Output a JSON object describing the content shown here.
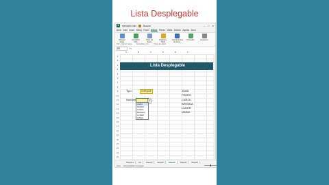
{
  "video_title": "Lista Desplegable",
  "window": {
    "title": "ejemplos.xlsx",
    "search": "Buscar"
  },
  "menu": [
    "Arch",
    "Inici",
    "Inser",
    "Dibuj",
    "Form",
    "Datos",
    "Revis",
    "Vista",
    "Autom",
    "Ayuda",
    "Acro"
  ],
  "menu_active": "Datos",
  "ribbon": {
    "groups": [
      {
        "label": "Obtener datos",
        "icon": "database-icon",
        "color": "#5b8fd0"
      },
      {
        "label": "Actualizar todo",
        "icon": "refresh-icon",
        "color": "#4a9b5e"
      },
      {
        "label": "Tipos de datos",
        "icon": "datatype-icon",
        "color": "#7a9acc"
      },
      {
        "label": "Ordenar y filtrar",
        "icon": "filter-icon",
        "color": "#d8a930"
      },
      {
        "label": "Herramientas de datos",
        "icon": "datatools-icon",
        "color": "#3d6fb0"
      },
      {
        "label": "Previsión",
        "icon": "forecast-icon",
        "color": "#5aa06a"
      },
      {
        "label": "Esquema",
        "icon": "outline-icon",
        "color": "#888888"
      }
    ],
    "group_captions": [
      "Obt. y transf. datos",
      "Consultas y co...",
      "Tipos de datos"
    ]
  },
  "namebox": "B5",
  "columns": [
    "A",
    "B",
    "C",
    "D",
    "E",
    "F"
  ],
  "rows": [
    "1",
    "2",
    "3",
    "4",
    "5",
    "6",
    "7",
    "8",
    "9",
    "10",
    "11",
    "12",
    "13",
    "14",
    "15",
    "16",
    "17",
    "18",
    "19",
    "20",
    "21",
    "22",
    "23",
    "24"
  ],
  "sheet": {
    "banner": "Lista Desplegable",
    "tipo_label": "Tipo:",
    "tipo_value": "CHEQUE",
    "nombre_label": "Nombre:",
    "dropdown_items": [
      "JUAN",
      "PEDRO",
      "CAROL",
      "BRENDA",
      "LUDER",
      "IANNA"
    ],
    "names_list": [
      "JUAN",
      "PEDRO",
      "CAROL",
      "BRENDA",
      "LUDER",
      "IANNA"
    ]
  },
  "tabs": [
    "Sheet11",
    "C6",
    "Sheet1",
    "Sheet2",
    "Sheet3",
    "Sheet4",
    "Sheet5"
  ],
  "tabs_active": "Sheet3",
  "status": {
    "left": "Listo",
    "accessibility": "Accesibilidad: investigar"
  }
}
